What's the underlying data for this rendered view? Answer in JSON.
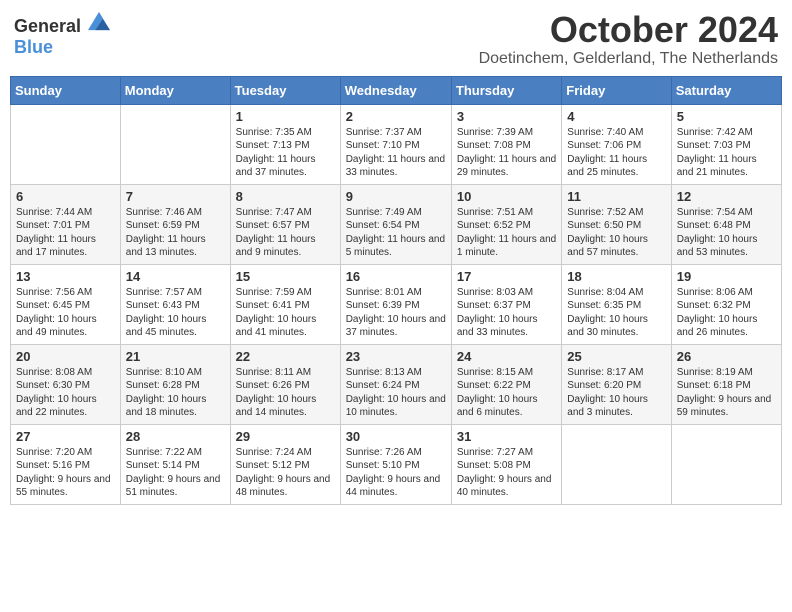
{
  "header": {
    "logo_general": "General",
    "logo_blue": "Blue",
    "month_year": "October 2024",
    "location": "Doetinchem, Gelderland, The Netherlands"
  },
  "weekdays": [
    "Sunday",
    "Monday",
    "Tuesday",
    "Wednesday",
    "Thursday",
    "Friday",
    "Saturday"
  ],
  "weeks": [
    [
      {
        "day": "",
        "info": ""
      },
      {
        "day": "",
        "info": ""
      },
      {
        "day": "1",
        "info": "Sunrise: 7:35 AM\nSunset: 7:13 PM\nDaylight: 11 hours and 37 minutes."
      },
      {
        "day": "2",
        "info": "Sunrise: 7:37 AM\nSunset: 7:10 PM\nDaylight: 11 hours and 33 minutes."
      },
      {
        "day": "3",
        "info": "Sunrise: 7:39 AM\nSunset: 7:08 PM\nDaylight: 11 hours and 29 minutes."
      },
      {
        "day": "4",
        "info": "Sunrise: 7:40 AM\nSunset: 7:06 PM\nDaylight: 11 hours and 25 minutes."
      },
      {
        "day": "5",
        "info": "Sunrise: 7:42 AM\nSunset: 7:03 PM\nDaylight: 11 hours and 21 minutes."
      }
    ],
    [
      {
        "day": "6",
        "info": "Sunrise: 7:44 AM\nSunset: 7:01 PM\nDaylight: 11 hours and 17 minutes."
      },
      {
        "day": "7",
        "info": "Sunrise: 7:46 AM\nSunset: 6:59 PM\nDaylight: 11 hours and 13 minutes."
      },
      {
        "day": "8",
        "info": "Sunrise: 7:47 AM\nSunset: 6:57 PM\nDaylight: 11 hours and 9 minutes."
      },
      {
        "day": "9",
        "info": "Sunrise: 7:49 AM\nSunset: 6:54 PM\nDaylight: 11 hours and 5 minutes."
      },
      {
        "day": "10",
        "info": "Sunrise: 7:51 AM\nSunset: 6:52 PM\nDaylight: 11 hours and 1 minute."
      },
      {
        "day": "11",
        "info": "Sunrise: 7:52 AM\nSunset: 6:50 PM\nDaylight: 10 hours and 57 minutes."
      },
      {
        "day": "12",
        "info": "Sunrise: 7:54 AM\nSunset: 6:48 PM\nDaylight: 10 hours and 53 minutes."
      }
    ],
    [
      {
        "day": "13",
        "info": "Sunrise: 7:56 AM\nSunset: 6:45 PM\nDaylight: 10 hours and 49 minutes."
      },
      {
        "day": "14",
        "info": "Sunrise: 7:57 AM\nSunset: 6:43 PM\nDaylight: 10 hours and 45 minutes."
      },
      {
        "day": "15",
        "info": "Sunrise: 7:59 AM\nSunset: 6:41 PM\nDaylight: 10 hours and 41 minutes."
      },
      {
        "day": "16",
        "info": "Sunrise: 8:01 AM\nSunset: 6:39 PM\nDaylight: 10 hours and 37 minutes."
      },
      {
        "day": "17",
        "info": "Sunrise: 8:03 AM\nSunset: 6:37 PM\nDaylight: 10 hours and 33 minutes."
      },
      {
        "day": "18",
        "info": "Sunrise: 8:04 AM\nSunset: 6:35 PM\nDaylight: 10 hours and 30 minutes."
      },
      {
        "day": "19",
        "info": "Sunrise: 8:06 AM\nSunset: 6:32 PM\nDaylight: 10 hours and 26 minutes."
      }
    ],
    [
      {
        "day": "20",
        "info": "Sunrise: 8:08 AM\nSunset: 6:30 PM\nDaylight: 10 hours and 22 minutes."
      },
      {
        "day": "21",
        "info": "Sunrise: 8:10 AM\nSunset: 6:28 PM\nDaylight: 10 hours and 18 minutes."
      },
      {
        "day": "22",
        "info": "Sunrise: 8:11 AM\nSunset: 6:26 PM\nDaylight: 10 hours and 14 minutes."
      },
      {
        "day": "23",
        "info": "Sunrise: 8:13 AM\nSunset: 6:24 PM\nDaylight: 10 hours and 10 minutes."
      },
      {
        "day": "24",
        "info": "Sunrise: 8:15 AM\nSunset: 6:22 PM\nDaylight: 10 hours and 6 minutes."
      },
      {
        "day": "25",
        "info": "Sunrise: 8:17 AM\nSunset: 6:20 PM\nDaylight: 10 hours and 3 minutes."
      },
      {
        "day": "26",
        "info": "Sunrise: 8:19 AM\nSunset: 6:18 PM\nDaylight: 9 hours and 59 minutes."
      }
    ],
    [
      {
        "day": "27",
        "info": "Sunrise: 7:20 AM\nSunset: 5:16 PM\nDaylight: 9 hours and 55 minutes."
      },
      {
        "day": "28",
        "info": "Sunrise: 7:22 AM\nSunset: 5:14 PM\nDaylight: 9 hours and 51 minutes."
      },
      {
        "day": "29",
        "info": "Sunrise: 7:24 AM\nSunset: 5:12 PM\nDaylight: 9 hours and 48 minutes."
      },
      {
        "day": "30",
        "info": "Sunrise: 7:26 AM\nSunset: 5:10 PM\nDaylight: 9 hours and 44 minutes."
      },
      {
        "day": "31",
        "info": "Sunrise: 7:27 AM\nSunset: 5:08 PM\nDaylight: 9 hours and 40 minutes."
      },
      {
        "day": "",
        "info": ""
      },
      {
        "day": "",
        "info": ""
      }
    ]
  ]
}
